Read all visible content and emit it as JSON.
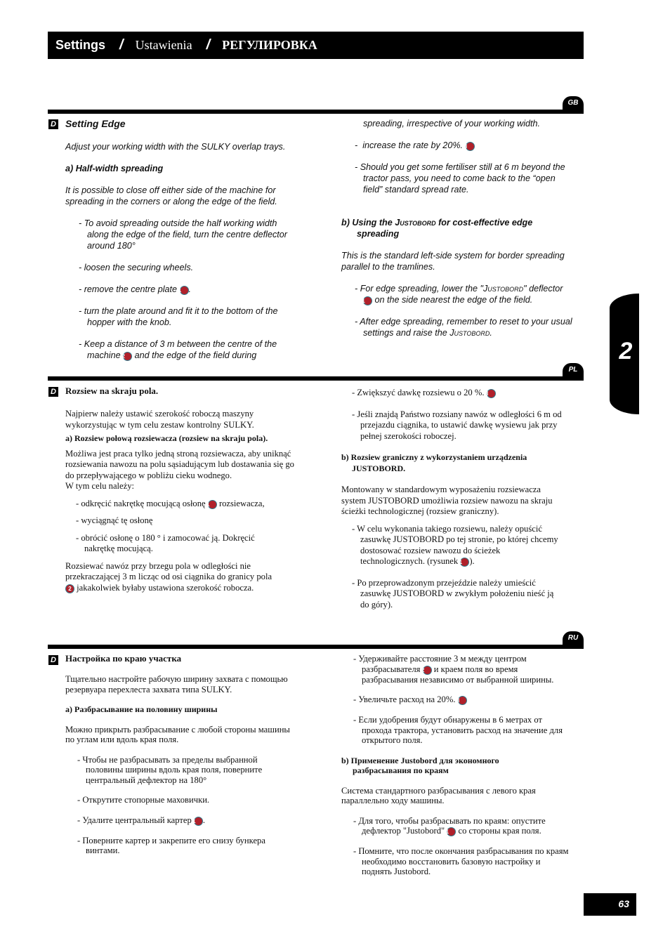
{
  "header": {
    "title_en": "Settings",
    "separator": "/",
    "title_pl": "Ustawienia",
    "title_ru": "РЕГУЛИРОВКА"
  },
  "chapter_tab": {
    "number": "2"
  },
  "page_number": "63",
  "colors": {
    "callout_fill": "#b0212b",
    "callout_ring": "#2f7b8e",
    "bars": "#000000"
  },
  "sections": {
    "gb": {
      "lang_tab": "GB",
      "section_icon": "D",
      "title": "Setting Edge",
      "intro": "Adjust your working width with the SULKY overlap trays.",
      "sub_a": "a) Half-width spreading",
      "para_a": "It is possible to close off either side of the machine for spreading in the corners or along the edge of the field.",
      "bullets_left": [
        {
          "text": "To avoid spreading outside the half working width along the edge of the field, turn the centre deflector around 180°"
        },
        {
          "text": "loosen the securing wheels."
        },
        {
          "pre": "remove the centre plate",
          "callout": "1",
          "post": "."
        },
        {
          "text": "turn the plate around and fit it to the bottom of the hopper with the knob."
        },
        {
          "pre": "Keep a distance of 3 m between the centre of the machine",
          "callout": "2",
          "post": "and the edge of the field during"
        }
      ],
      "continued": "spreading, irrespective of your working width.",
      "bullets_right": [
        {
          "pre": "increase the rate by 20%.",
          "callout": "3",
          "post": ""
        },
        {
          "text": "Should you get some fertiliser still at 6 m beyond the tractor pass, you need to come back to the “open field” standard spread rate."
        }
      ],
      "sub_b_pre": "b)  Using the",
      "sub_b_brand": "Justobord",
      "sub_b_post": "for cost-effective edge spreading",
      "para_b": "This is the standard left-side system for border spreading parallel to the tramlines.",
      "bullets_b": [
        {
          "pre": "For edge spreading, lower the \"",
          "brand": "Justobord",
          "mid": "\" deflector",
          "callout": "1",
          "post": "on the side nearest the edge of the field."
        },
        {
          "pre": "After edge spreading, remember to reset to your usual settings and raise the",
          "brand": "Justobord",
          "post": "."
        }
      ]
    },
    "pl": {
      "lang_tab": "PL",
      "section_icon": "D",
      "title": "Rozsiew na skraju pola.",
      "intro": "Najpierw należy ustawić szerokość roboczą maszyny wykorzystując w tym celu zestaw kontrolny SULKY.",
      "sub_a": "a) Rozsiew połową rozsiewacza (rozsiew na skraju pola).",
      "para_a": "Możliwa jest praca tylko jedną stroną rozsiewacza, aby uniknąć rozsiewania nawozu na polu sąsiadującym lub dostawania się go do przepływającego w pobliżu cieku wodnego.",
      "para_a2": "W tym celu należy:",
      "bullets_left": [
        {
          "pre": "- odkręcić nakrętkę mocującą osłonę",
          "callout": "1",
          "post": "rozsiewacza,"
        },
        {
          "text": "- wyciągnąć tę osłonę"
        },
        {
          "text": "- obrócić osłonę o 180 ° i zamocować ją. Dokręcić nakrętkę mocującą."
        }
      ],
      "para_edge_pre": "Rozsiewać nawóz przy brzegu pola w odległości nie przekraczającej 3 m licząc od osi ciągnika do granicy pola",
      "para_edge_callout": "2",
      "para_edge_post": "jakakolwiek byłaby ustawiona szerokość robocza.",
      "bullets_right": [
        {
          "pre": "- Zwiększyć dawkę rozsiewu o 20 %.",
          "callout": "3",
          "post": ""
        },
        {
          "text": "- Jeśli znajdą Państwo rozsiany nawóz w odległości 6 m od przejazdu ciągnika, to ustawić dawkę wysiewu jak przy pełnej szerokości roboczej."
        }
      ],
      "sub_b": "b) Rozsiew graniczny z wykorzystaniem urządzenia JUSTOBORD.",
      "para_b": "Montowany w standardowym wyposażeniu rozsiewacza system JUSTOBORD umożliwia rozsiew nawozu na skraju ścieżki technologicznej (rozsiew graniczny).",
      "bullets_b": [
        {
          "pre": "- W celu wykonania takiego rozsiewu, należy opuścić zasuwkę JUSTOBORD po tej stronie, po której chcemy dostosować rozsiew nawozu do ścieżek technologicznych. (rysunek",
          "callout": "1",
          "post": ")."
        },
        {
          "text": "- Po przeprowadzonym przejeździe należy umieścić zasuwkę JUSTOBORD w zwykłym położeniu nieść ją do góry)."
        }
      ]
    },
    "ru": {
      "lang_tab": "RU",
      "section_icon": "D",
      "title": "Настройка по краю участка",
      "intro": "Тщательно настройте рабочую ширину захвата с помощью резервуара перехлеста захвата типа SULKY.",
      "sub_a": "а) Разбрасывание на половину ширины",
      "para_a": "Можно прикрыть разбрасывание с любой стороны машины по углам или вдоль края поля.",
      "bullets_left": [
        {
          "text": "- Чтобы не разбрасывать за пределы выбранной половины ширины вдоль края поля, поверните центральный дефлектор на 180°"
        },
        {
          "text": "- Открутите стопорные маховички."
        },
        {
          "pre": "- Удалите центральный картер",
          "callout": "1",
          "post": "."
        },
        {
          "text": "- Поверните картер и закрепите его снизу бункера винтами."
        }
      ],
      "bullets_right": [
        {
          "pre": "- Удерживайте расстояние 3 м между центром разбрасывателя",
          "callout": "2",
          "post": "и краем поля во время разбрасывания независимо от выбранной ширины."
        },
        {
          "pre": "- Увеличьте расход на 20%.",
          "callout": "3",
          "post": ""
        },
        {
          "text": "- Если удобрения будут обнаружены в 6 метрах от прохода трактора, установить расход на значение для открытого поля."
        }
      ],
      "sub_b": "b) Применение Justobord для экономного разбрасывания по краям",
      "para_b": "Система стандартного разбрасывания с левого края параллельно ходу машины.",
      "bullets_b": [
        {
          "pre": "- Для того, чтобы разбрасывать по краям: опустите дефлектор \"Justobord\"",
          "callout": "1",
          "post": "со стороны края поля."
        },
        {
          "text": "- Помните, что после окончания разбрасывания по краям необходимо восстановить базовую настройку и поднять Justobord."
        }
      ]
    }
  }
}
